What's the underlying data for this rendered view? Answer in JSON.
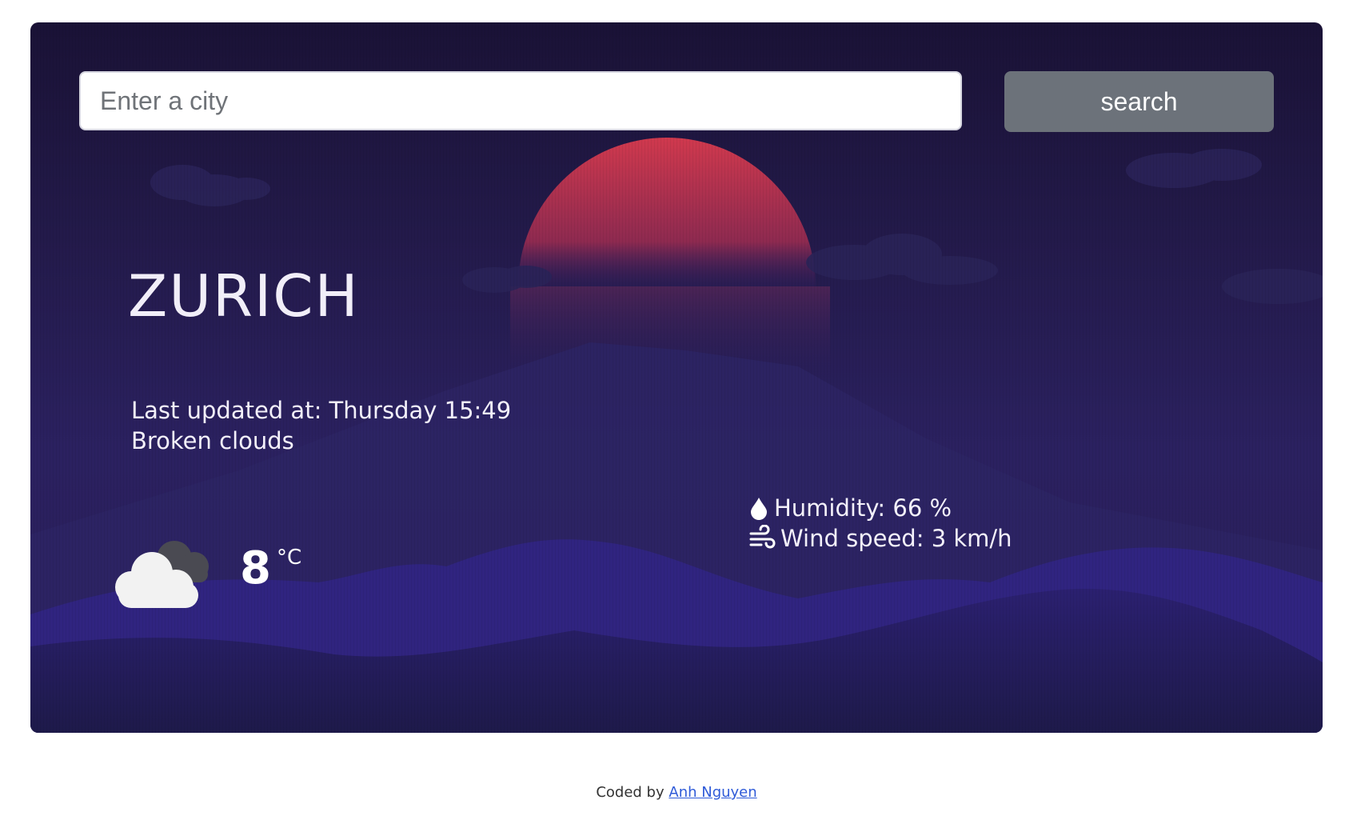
{
  "search": {
    "placeholder": "Enter a city",
    "button_label": "search"
  },
  "weather": {
    "city": "ZURICH",
    "last_updated_label": "Last updated at: Thursday 15:49",
    "description": "Broken clouds",
    "temperature": "8",
    "unit": "°C",
    "humidity_label": "Humidity: 66 %",
    "wind_label": "Wind speed: 3 km/h",
    "icon": "broken-clouds-icon"
  },
  "footer": {
    "prefix": "Coded by",
    "author": "Anh Nguyen"
  },
  "colors": {
    "accent_sun": "#c93a4f",
    "button_bg": "#6c727a",
    "link": "#2f5bd8"
  }
}
